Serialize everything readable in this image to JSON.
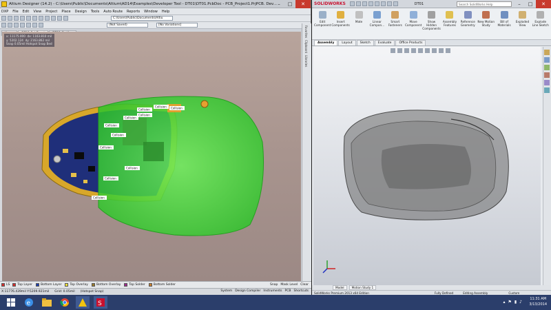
{
  "altium": {
    "title": "Altium Designer (14.2) - C:\\Users\\Public\\Documents\\Altium\\AD14\\Examples\\Developer Tool - DT01\\DT01.PcbDoc - PCB_Project1.PrjPCB. Dev...",
    "menu": [
      "DXP",
      "File",
      "Edit",
      "View",
      "Project",
      "Place",
      "Design",
      "Tools",
      "Auto Route",
      "Reports",
      "Window",
      "Help"
    ],
    "path_combo": "C:\\Users\\Public\\Documents\\Altiu",
    "saved_combo": "(Not Saved)",
    "variations_combo": "[No Variations]",
    "tabs": [
      "Home",
      "DT01.PcbDoc *",
      "DT01 Outline"
    ],
    "coords": {
      "x": "x: 11175.000",
      "dx": "dx: 1103.810 mil",
      "y": "y: 5202.124",
      "dy": "dy: 2163.862 mil",
      "snap": "Snap 0.05mil Hotspot Snap Bed"
    },
    "right_panels": [
      "Favorites",
      "Clipboard",
      "Libraries"
    ],
    "collision_label": "Collision",
    "layers": [
      {
        "name": "Top Layer",
        "color": "#d32f2f"
      },
      {
        "name": "Bottom Layer",
        "color": "#1e3fae"
      },
      {
        "name": "Top Overlay",
        "color": "#f2e23b"
      },
      {
        "name": "Bottom Overlay",
        "color": "#9a7b2f"
      },
      {
        "name": "Top Solder",
        "color": "#9c2b8c"
      },
      {
        "name": "Bottom Solder",
        "color": "#c87f30"
      }
    ],
    "ls_label": "LS",
    "layer_btns": [
      "Snap",
      "Mask Level",
      "Clear"
    ],
    "status": {
      "coord": "X:11776.439mil Y:5209.921mil",
      "grid": "Grid: 0.05mil",
      "hotspot": "(Hotspot Snap)",
      "btns": [
        "System",
        "Design Compiler",
        "Instruments",
        "PCB",
        "Shortcuts"
      ]
    }
  },
  "solidworks": {
    "logo": "SOLIDWORKS",
    "title": "DT01",
    "search": "Search SolidWorks Help",
    "ribbon": [
      "Edit Component",
      "Insert Components",
      "Mate",
      "Linear Compon...",
      "Smart Fasteners",
      "Move Component",
      "Show Hidden Components",
      "Assembly Features",
      "Reference Geometry",
      "New Motion Study",
      "Bill of Materials",
      "Exploded View",
      "Explode Line Sketch"
    ],
    "tabs": [
      "Assembly",
      "Layout",
      "Sketch",
      "Evaluate",
      "Office Products"
    ],
    "model_tabs": [
      "Model",
      "Motion Study 1"
    ],
    "status_left": "SolidWorks Premium 2013 x64 Edition",
    "status_fully": "Fully Defined",
    "status_edit": "Editing Assembly",
    "status_custom": "Custom"
  },
  "taskbar": {
    "time": "11:31 AM",
    "date": "3/13/2014"
  }
}
